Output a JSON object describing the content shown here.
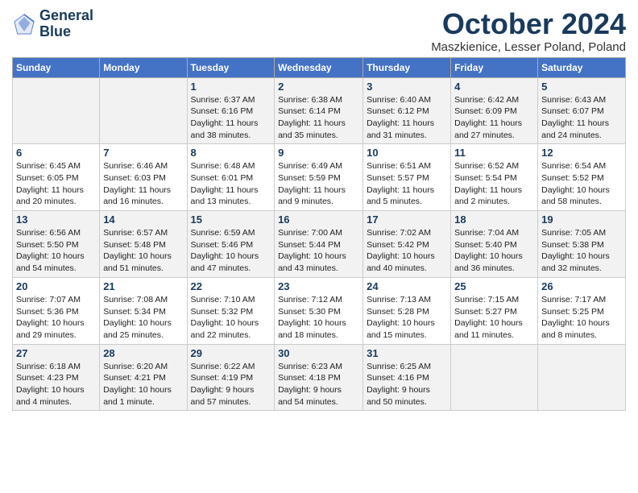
{
  "header": {
    "logo_line1": "General",
    "logo_line2": "Blue",
    "month": "October 2024",
    "location": "Maszkienice, Lesser Poland, Poland"
  },
  "days_of_week": [
    "Sunday",
    "Monday",
    "Tuesday",
    "Wednesday",
    "Thursday",
    "Friday",
    "Saturday"
  ],
  "weeks": [
    [
      {
        "day": "",
        "info": ""
      },
      {
        "day": "",
        "info": ""
      },
      {
        "day": "1",
        "info": "Sunrise: 6:37 AM\nSunset: 6:16 PM\nDaylight: 11 hours\nand 38 minutes."
      },
      {
        "day": "2",
        "info": "Sunrise: 6:38 AM\nSunset: 6:14 PM\nDaylight: 11 hours\nand 35 minutes."
      },
      {
        "day": "3",
        "info": "Sunrise: 6:40 AM\nSunset: 6:12 PM\nDaylight: 11 hours\nand 31 minutes."
      },
      {
        "day": "4",
        "info": "Sunrise: 6:42 AM\nSunset: 6:09 PM\nDaylight: 11 hours\nand 27 minutes."
      },
      {
        "day": "5",
        "info": "Sunrise: 6:43 AM\nSunset: 6:07 PM\nDaylight: 11 hours\nand 24 minutes."
      }
    ],
    [
      {
        "day": "6",
        "info": "Sunrise: 6:45 AM\nSunset: 6:05 PM\nDaylight: 11 hours\nand 20 minutes."
      },
      {
        "day": "7",
        "info": "Sunrise: 6:46 AM\nSunset: 6:03 PM\nDaylight: 11 hours\nand 16 minutes."
      },
      {
        "day": "8",
        "info": "Sunrise: 6:48 AM\nSunset: 6:01 PM\nDaylight: 11 hours\nand 13 minutes."
      },
      {
        "day": "9",
        "info": "Sunrise: 6:49 AM\nSunset: 5:59 PM\nDaylight: 11 hours\nand 9 minutes."
      },
      {
        "day": "10",
        "info": "Sunrise: 6:51 AM\nSunset: 5:57 PM\nDaylight: 11 hours\nand 5 minutes."
      },
      {
        "day": "11",
        "info": "Sunrise: 6:52 AM\nSunset: 5:54 PM\nDaylight: 11 hours\nand 2 minutes."
      },
      {
        "day": "12",
        "info": "Sunrise: 6:54 AM\nSunset: 5:52 PM\nDaylight: 10 hours\nand 58 minutes."
      }
    ],
    [
      {
        "day": "13",
        "info": "Sunrise: 6:56 AM\nSunset: 5:50 PM\nDaylight: 10 hours\nand 54 minutes."
      },
      {
        "day": "14",
        "info": "Sunrise: 6:57 AM\nSunset: 5:48 PM\nDaylight: 10 hours\nand 51 minutes."
      },
      {
        "day": "15",
        "info": "Sunrise: 6:59 AM\nSunset: 5:46 PM\nDaylight: 10 hours\nand 47 minutes."
      },
      {
        "day": "16",
        "info": "Sunrise: 7:00 AM\nSunset: 5:44 PM\nDaylight: 10 hours\nand 43 minutes."
      },
      {
        "day": "17",
        "info": "Sunrise: 7:02 AM\nSunset: 5:42 PM\nDaylight: 10 hours\nand 40 minutes."
      },
      {
        "day": "18",
        "info": "Sunrise: 7:04 AM\nSunset: 5:40 PM\nDaylight: 10 hours\nand 36 minutes."
      },
      {
        "day": "19",
        "info": "Sunrise: 7:05 AM\nSunset: 5:38 PM\nDaylight: 10 hours\nand 32 minutes."
      }
    ],
    [
      {
        "day": "20",
        "info": "Sunrise: 7:07 AM\nSunset: 5:36 PM\nDaylight: 10 hours\nand 29 minutes."
      },
      {
        "day": "21",
        "info": "Sunrise: 7:08 AM\nSunset: 5:34 PM\nDaylight: 10 hours\nand 25 minutes."
      },
      {
        "day": "22",
        "info": "Sunrise: 7:10 AM\nSunset: 5:32 PM\nDaylight: 10 hours\nand 22 minutes."
      },
      {
        "day": "23",
        "info": "Sunrise: 7:12 AM\nSunset: 5:30 PM\nDaylight: 10 hours\nand 18 minutes."
      },
      {
        "day": "24",
        "info": "Sunrise: 7:13 AM\nSunset: 5:28 PM\nDaylight: 10 hours\nand 15 minutes."
      },
      {
        "day": "25",
        "info": "Sunrise: 7:15 AM\nSunset: 5:27 PM\nDaylight: 10 hours\nand 11 minutes."
      },
      {
        "day": "26",
        "info": "Sunrise: 7:17 AM\nSunset: 5:25 PM\nDaylight: 10 hours\nand 8 minutes."
      }
    ],
    [
      {
        "day": "27",
        "info": "Sunrise: 6:18 AM\nSunset: 4:23 PM\nDaylight: 10 hours\nand 4 minutes."
      },
      {
        "day": "28",
        "info": "Sunrise: 6:20 AM\nSunset: 4:21 PM\nDaylight: 10 hours\nand 1 minute."
      },
      {
        "day": "29",
        "info": "Sunrise: 6:22 AM\nSunset: 4:19 PM\nDaylight: 9 hours\nand 57 minutes."
      },
      {
        "day": "30",
        "info": "Sunrise: 6:23 AM\nSunset: 4:18 PM\nDaylight: 9 hours\nand 54 minutes."
      },
      {
        "day": "31",
        "info": "Sunrise: 6:25 AM\nSunset: 4:16 PM\nDaylight: 9 hours\nand 50 minutes."
      },
      {
        "day": "",
        "info": ""
      },
      {
        "day": "",
        "info": ""
      }
    ]
  ]
}
